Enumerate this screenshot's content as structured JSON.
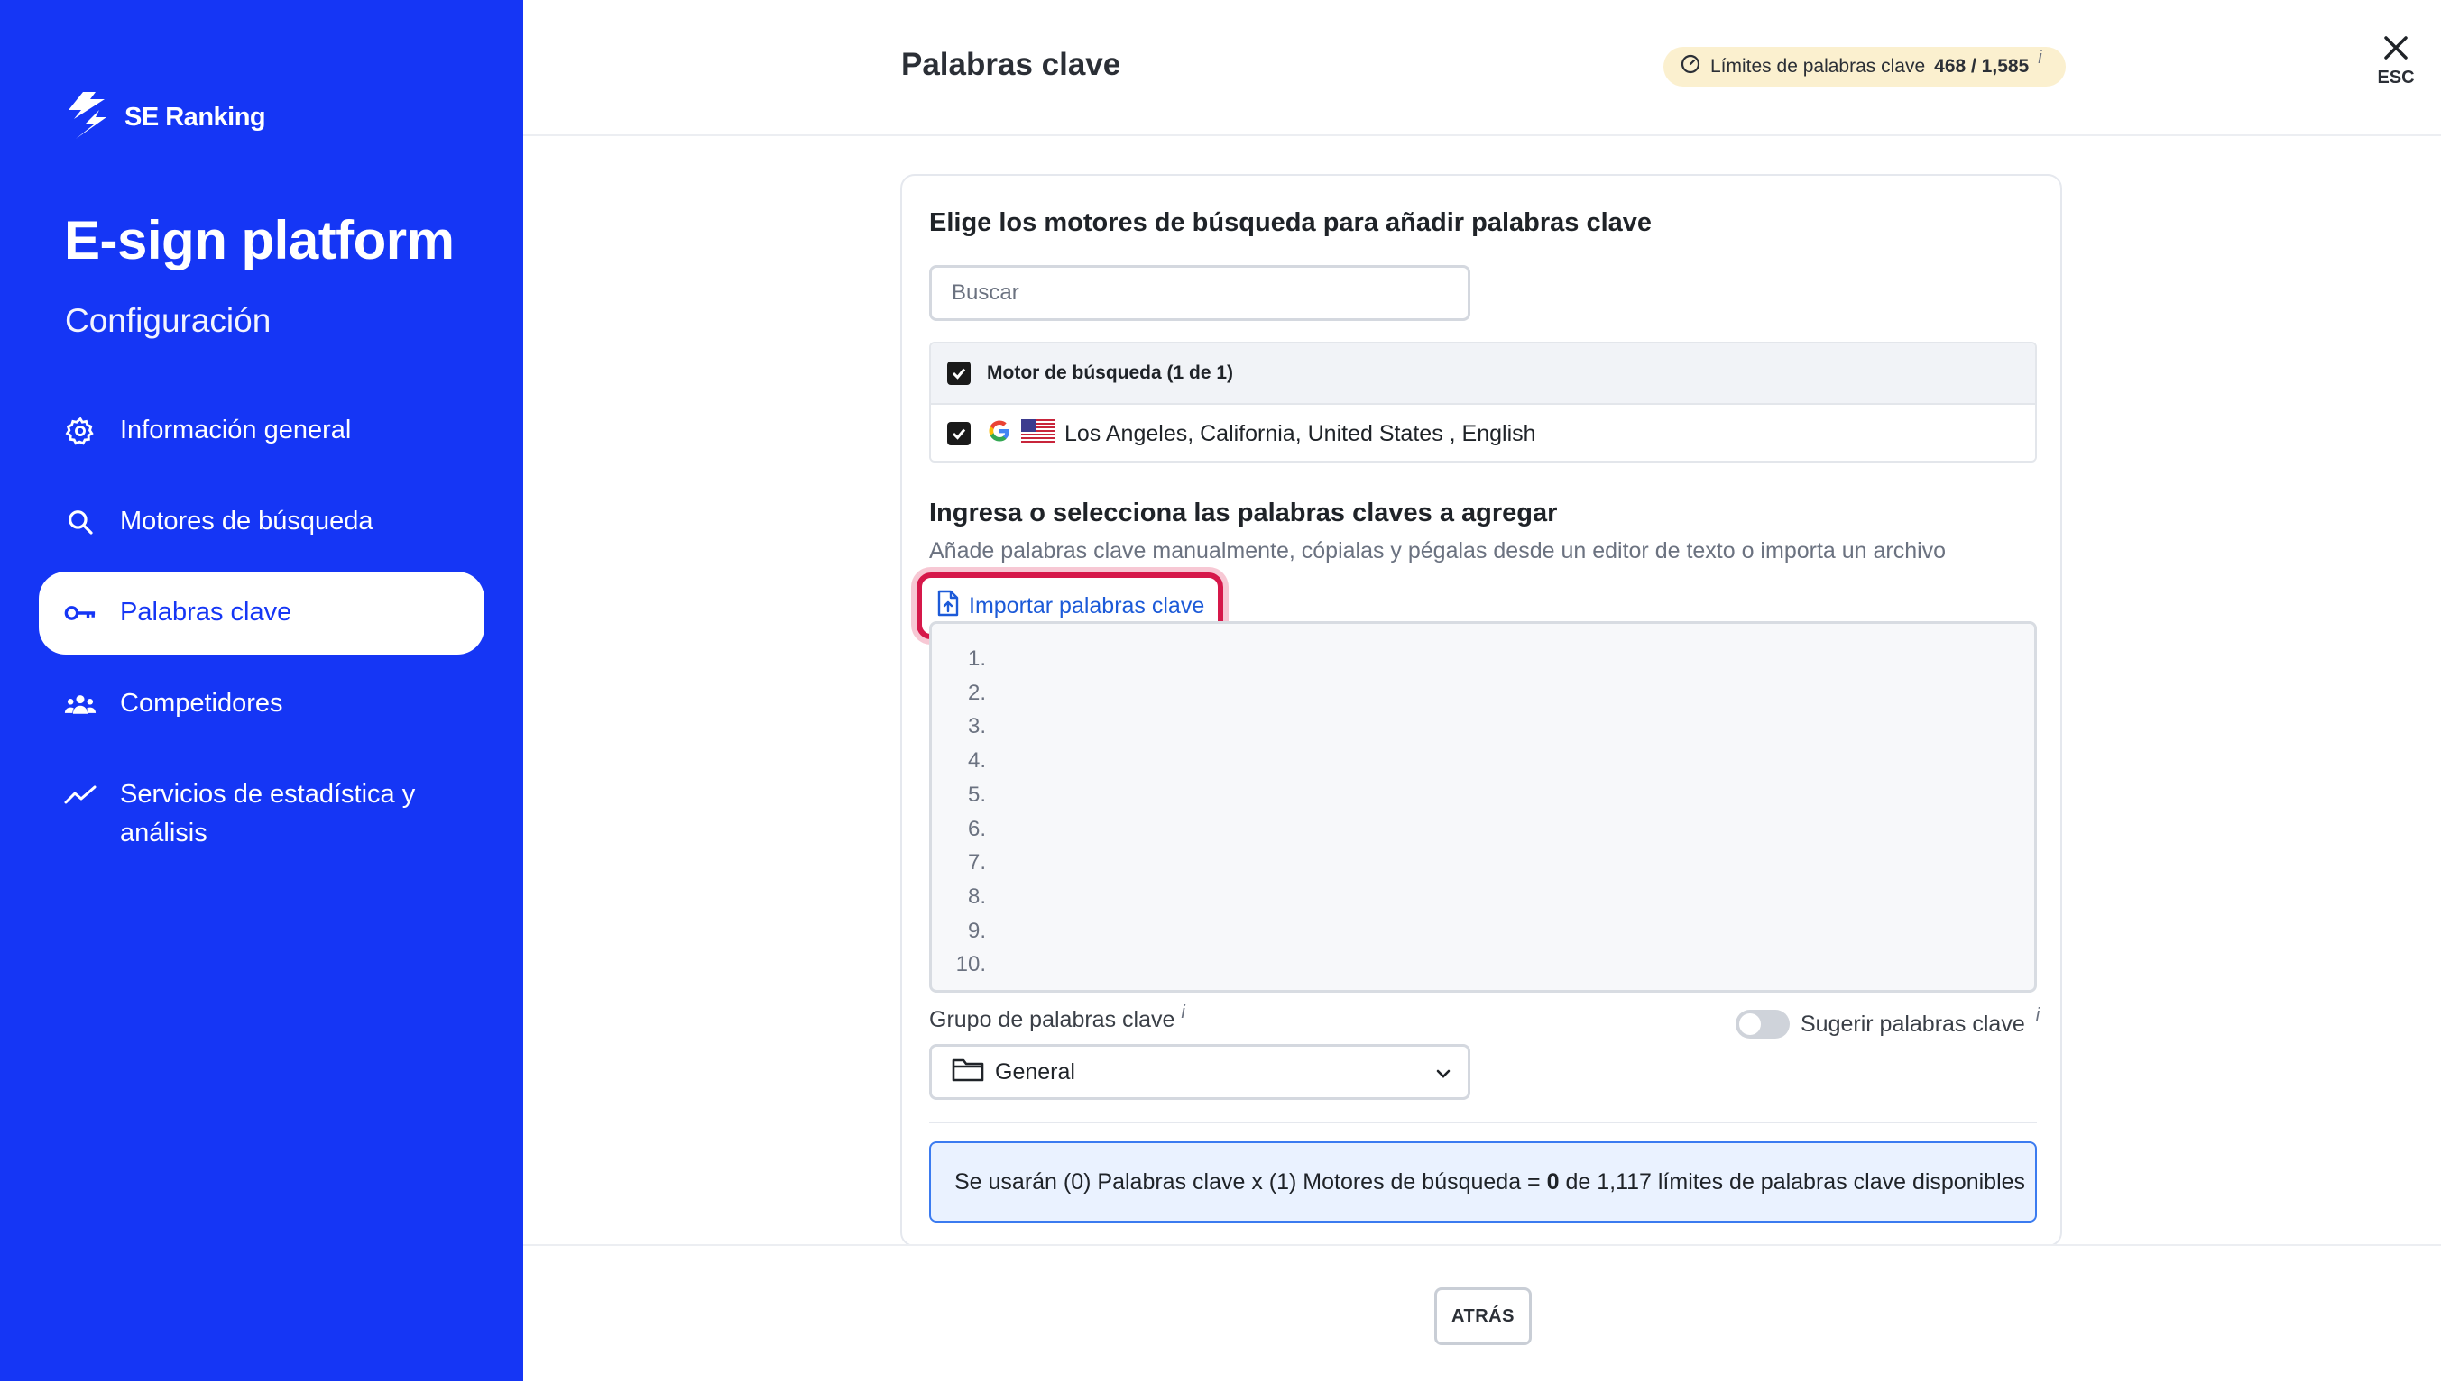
{
  "sidebar": {
    "brand": "SE Ranking",
    "project_title": "E-sign platform",
    "project_subtitle": "Configuración",
    "items": [
      {
        "label": "Información general",
        "icon": "gear-icon",
        "active": false
      },
      {
        "label": "Motores de búsqueda",
        "icon": "search-icon",
        "active": false
      },
      {
        "label": "Palabras clave",
        "icon": "key-icon",
        "active": true
      },
      {
        "label": "Competidores",
        "icon": "users-icon",
        "active": false
      },
      {
        "label": "Servicios de estadística y",
        "label2": "análisis",
        "icon": "trend-icon",
        "active": false
      }
    ]
  },
  "header": {
    "title": "Palabras clave",
    "limits_label": "Límites de palabras clave",
    "limits_value": "468 / 1,585",
    "info_mark": "i",
    "close_label": "ESC"
  },
  "engines": {
    "heading": "Elige los motores de búsqueda para añadir palabras clave",
    "search_placeholder": "Buscar",
    "table_header": "Motor de búsqueda (1 de 1)",
    "rows": [
      {
        "label": "Los Angeles, California, United States , English",
        "checked": true
      }
    ]
  },
  "keywords": {
    "heading": "Ingresa o selecciona las palabras claves a agregar",
    "description": "Añade palabras clave manualmente, cópialas y pégalas desde un editor de texto o importa un archivo",
    "import_label": "Importar palabras clave",
    "line_numbers": [
      "1.",
      "2.",
      "3.",
      "4.",
      "5.",
      "6.",
      "7.",
      "8.",
      "9.",
      "10."
    ],
    "group_label": "Grupo de palabras clave",
    "group_value": "General",
    "suggest_label": "Sugerir palabras clave",
    "info_mark": "i"
  },
  "summary": {
    "part1": "Se usarán (0) Palabras clave x (1) Motores de búsqueda = ",
    "bold_value": "0",
    "part2": " de 1,117 límites de palabras clave disponibles"
  },
  "footer": {
    "back_label": "ATRÁS"
  },
  "colors": {
    "brand": "#1536f5",
    "highlight": "#d6184a",
    "link": "#1c5ad8",
    "limits_bg": "#fbf0cf",
    "info_border": "#3b7bf0"
  }
}
